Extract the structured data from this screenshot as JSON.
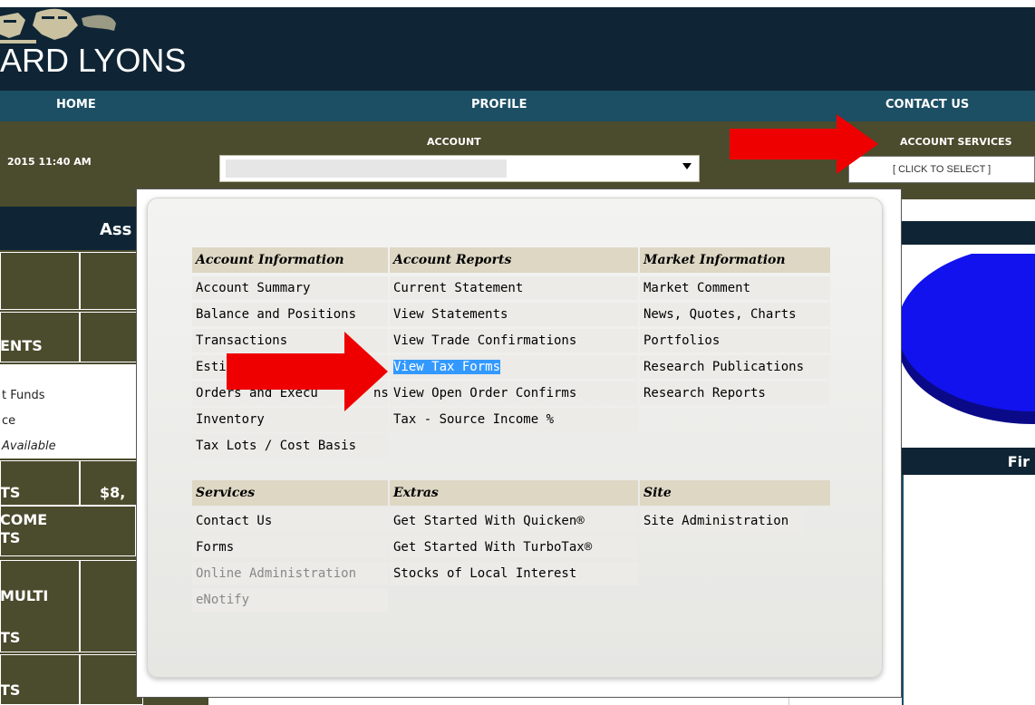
{
  "brand": {
    "name": "ARD LYONS"
  },
  "nav": {
    "home": "HOME",
    "profile": "PROFILE",
    "contact": "CONTACT US"
  },
  "account_bar": {
    "datetime": "2015 11:40 AM",
    "account_label": "ACCOUNT",
    "services_label": "ACCOUNT SERVICES",
    "services_select": "[ CLICK TO SELECT ]"
  },
  "background": {
    "left_title": "Ass",
    "left_rows": [
      "ENTS",
      "t Funds",
      "ce",
      "Available",
      "TS",
      "$8,",
      "COME",
      "TS",
      "MULTI",
      "TS",
      "TS"
    ],
    "right_title2": "Fir"
  },
  "menu": {
    "columns": [
      {
        "header": "Account Information",
        "items": [
          "Account Summary",
          "Balance and Positions",
          "Transactions",
          "Esti",
          "Orders and Execu",
          "Inventory",
          "Tax Lots / Cost Basis"
        ]
      },
      {
        "header": "Account Reports",
        "items": [
          "Current Statement",
          "View Statements",
          "View Trade Confirmations",
          "View Tax Forms",
          "View Open Order Confirms",
          "Tax - Source Income %"
        ]
      },
      {
        "header": "Market Information",
        "items": [
          "Market Comment",
          "News, Quotes, Charts",
          "Portfolios",
          "Research Publications",
          "Research Reports"
        ]
      }
    ],
    "columns2": [
      {
        "header": "Services",
        "items": [
          "Contact Us",
          "Forms",
          "Online Administration",
          "eNotify"
        ]
      },
      {
        "header": "Extras",
        "items": [
          "Get Started With Quicken®",
          "Get Started With TurboTax®",
          "Stocks of Local Interest"
        ]
      },
      {
        "header": "Site",
        "items": [
          "Site Administration"
        ]
      }
    ],
    "orders_suffix": "ns"
  },
  "colors": {
    "arrow": "#ee0000",
    "header_bg": "#0f2535",
    "nav_bg": "#1c4e64",
    "bar_bg": "#4b4b2e",
    "highlight": "#3399ff",
    "pie": "#1010ee"
  }
}
